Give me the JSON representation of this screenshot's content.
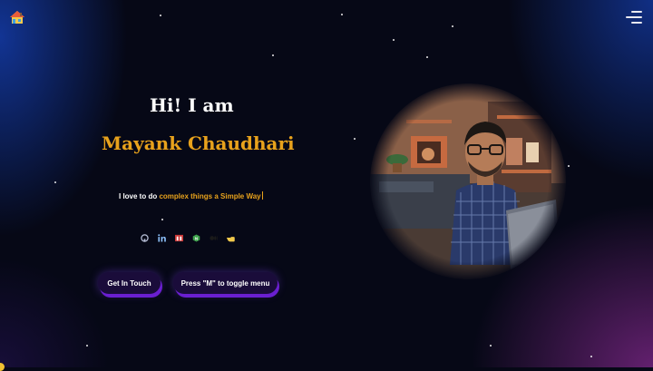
{
  "header": {
    "logo_icon": "house-icon",
    "menu_icon": "hamburger-menu-icon"
  },
  "hero": {
    "greeting": "Hi! I am",
    "name": "Mayank Chaudhari",
    "tagline_prefix": "I love to do ",
    "tagline_highlight": "complex things a Simple Way",
    "accent_color": "#e8a21c"
  },
  "social": [
    {
      "name": "github-icon"
    },
    {
      "name": "linkedin-icon"
    },
    {
      "name": "npm-icon"
    },
    {
      "name": "nodejs-icon"
    },
    {
      "name": "medium-icon"
    },
    {
      "name": "hand-pointing-icon"
    }
  ],
  "buttons": {
    "contact_label": "Get In Touch",
    "menu_toggle_label": "Press \"M\" to toggle menu"
  },
  "portrait": {
    "description_icon": "profile-photo"
  }
}
